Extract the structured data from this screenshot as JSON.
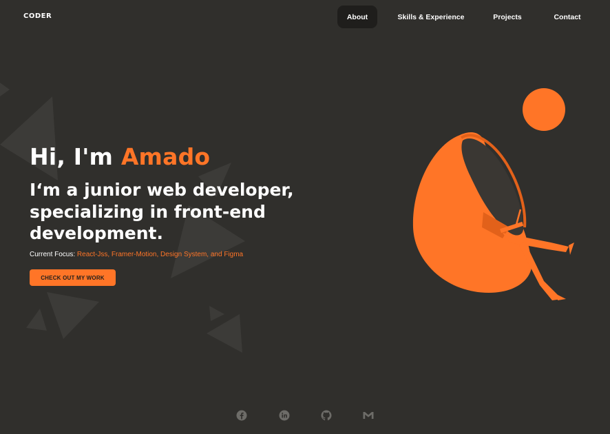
{
  "header": {
    "logo": "CODER",
    "nav": [
      {
        "label": "About",
        "active": true
      },
      {
        "label": "Skills & Experience",
        "active": false
      },
      {
        "label": "Projects",
        "active": false
      },
      {
        "label": "Contact",
        "active": false
      }
    ]
  },
  "hero": {
    "greeting": "Hi, I'm ",
    "name": "Amado",
    "subtitle": "I‘m a junior web developer, specializing in front-end development.",
    "focus_label": "Current Focus: ",
    "focus_value": "React-Jss, Framer-Motion, Design System, and Figma",
    "cta_label": "CHECK OUT MY WORK"
  },
  "illustration": {
    "icon": "person-in-egg-chair-illustration"
  },
  "social": [
    {
      "icon": "facebook-icon"
    },
    {
      "icon": "linkedin-icon"
    },
    {
      "icon": "github-icon"
    },
    {
      "icon": "gmail-icon"
    }
  ],
  "colors": {
    "background": "#302f2c",
    "accent": "#ff7527",
    "text": "#ffffff",
    "nav_active_bg": "#1f1e1c",
    "icon_muted": "#6d6c68"
  }
}
